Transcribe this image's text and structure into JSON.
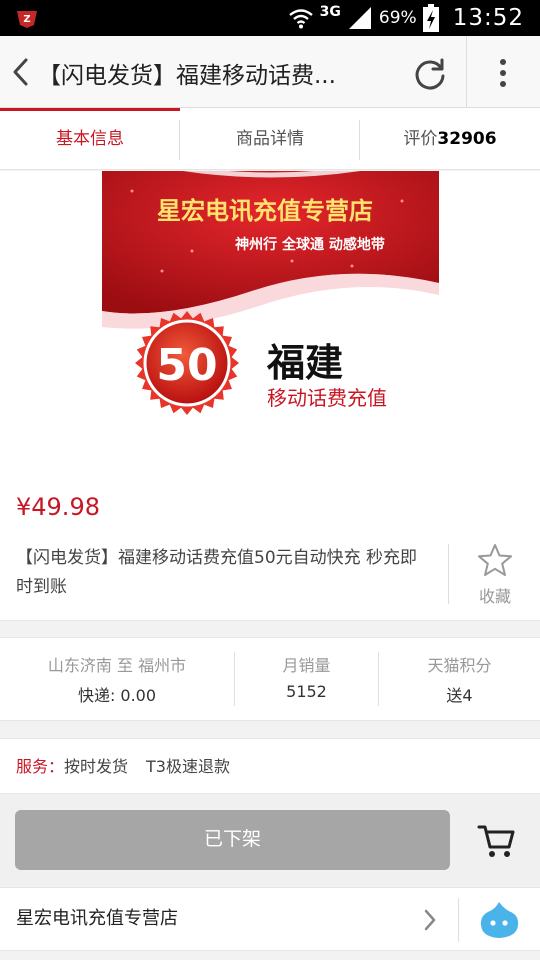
{
  "status_bar": {
    "network": "3G",
    "battery": "69%",
    "time": "13:52",
    "icons": [
      "app-notification-icon",
      "wifi-icon",
      "signal-icon",
      "battery-charging-icon"
    ]
  },
  "title_bar": {
    "title": "【闪电发货】福建移动话费...",
    "icons": [
      "back-icon",
      "refresh-icon",
      "more-vertical-icon"
    ]
  },
  "tabs": [
    {
      "label": "基本信息",
      "active": true
    },
    {
      "label": "商品详情",
      "active": false
    },
    {
      "label": "评价",
      "count": "32906",
      "active": false
    }
  ],
  "banner": {
    "store_name": "星宏电讯充值专营店",
    "slogans": "神州行  全球通  动感地带",
    "amount": "50",
    "province": "福建",
    "product_type": "移动话费充值"
  },
  "product": {
    "price": "¥49.98",
    "title": "【闪电发货】福建移动话费充值50元自动快充 秒充即时到账",
    "favorite_label": "收藏"
  },
  "stats": [
    {
      "label": "山东济南 至 福州市",
      "value": "快递: 0.00"
    },
    {
      "label": "月销量",
      "value": "5152"
    },
    {
      "label": "天猫积分",
      "value": "送4"
    }
  ],
  "services": {
    "label": "服务：",
    "items": [
      "按时发货",
      "T3极速退款"
    ]
  },
  "action_bar": {
    "status_button": "已下架",
    "cart_icon": "cart-icon"
  },
  "shop": {
    "name": "星宏电讯充值专营店",
    "icons": [
      "chevron-right-icon",
      "chat-icon"
    ]
  },
  "colors": {
    "accent": "#c81623",
    "disabled_button": "#a6a6a6",
    "chat_icon": "#4ab3ea"
  }
}
